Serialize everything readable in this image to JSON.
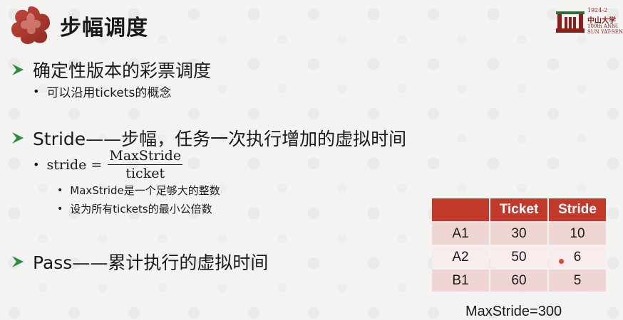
{
  "header": {
    "title": "步幅调度",
    "logo_icon": "quatrefoil-logo",
    "university_logo_icon": "university-logo",
    "university_text": {
      "years": "1924-2",
      "name_cn": "中山大学",
      "anniversary": "100th ANNI",
      "name_en": "SUN YAT-SEN U"
    }
  },
  "bullets": {
    "b1": {
      "text": "确定性版本的彩票调度",
      "sub": "可以沿用tickets的概念"
    },
    "b2": {
      "text": "Stride——步幅，任务一次执行增加的虚拟时间",
      "formula": {
        "lhs": "stride =",
        "numerator": "MaxStride",
        "denominator": "ticket"
      },
      "subs": [
        "MaxStride是一个足够大的整数",
        "设为所有tickets的最小公倍数"
      ]
    },
    "b3": {
      "text": "Pass——累计执行的虚拟时间"
    }
  },
  "table": {
    "headers": [
      "",
      "Ticket",
      "Stride"
    ],
    "rows": [
      [
        "A1",
        "30",
        "10"
      ],
      [
        "A2",
        "50",
        "6"
      ],
      [
        "B1",
        "60",
        "5"
      ]
    ],
    "header_color": "#c0392b"
  },
  "note": "MaxStride=300"
}
